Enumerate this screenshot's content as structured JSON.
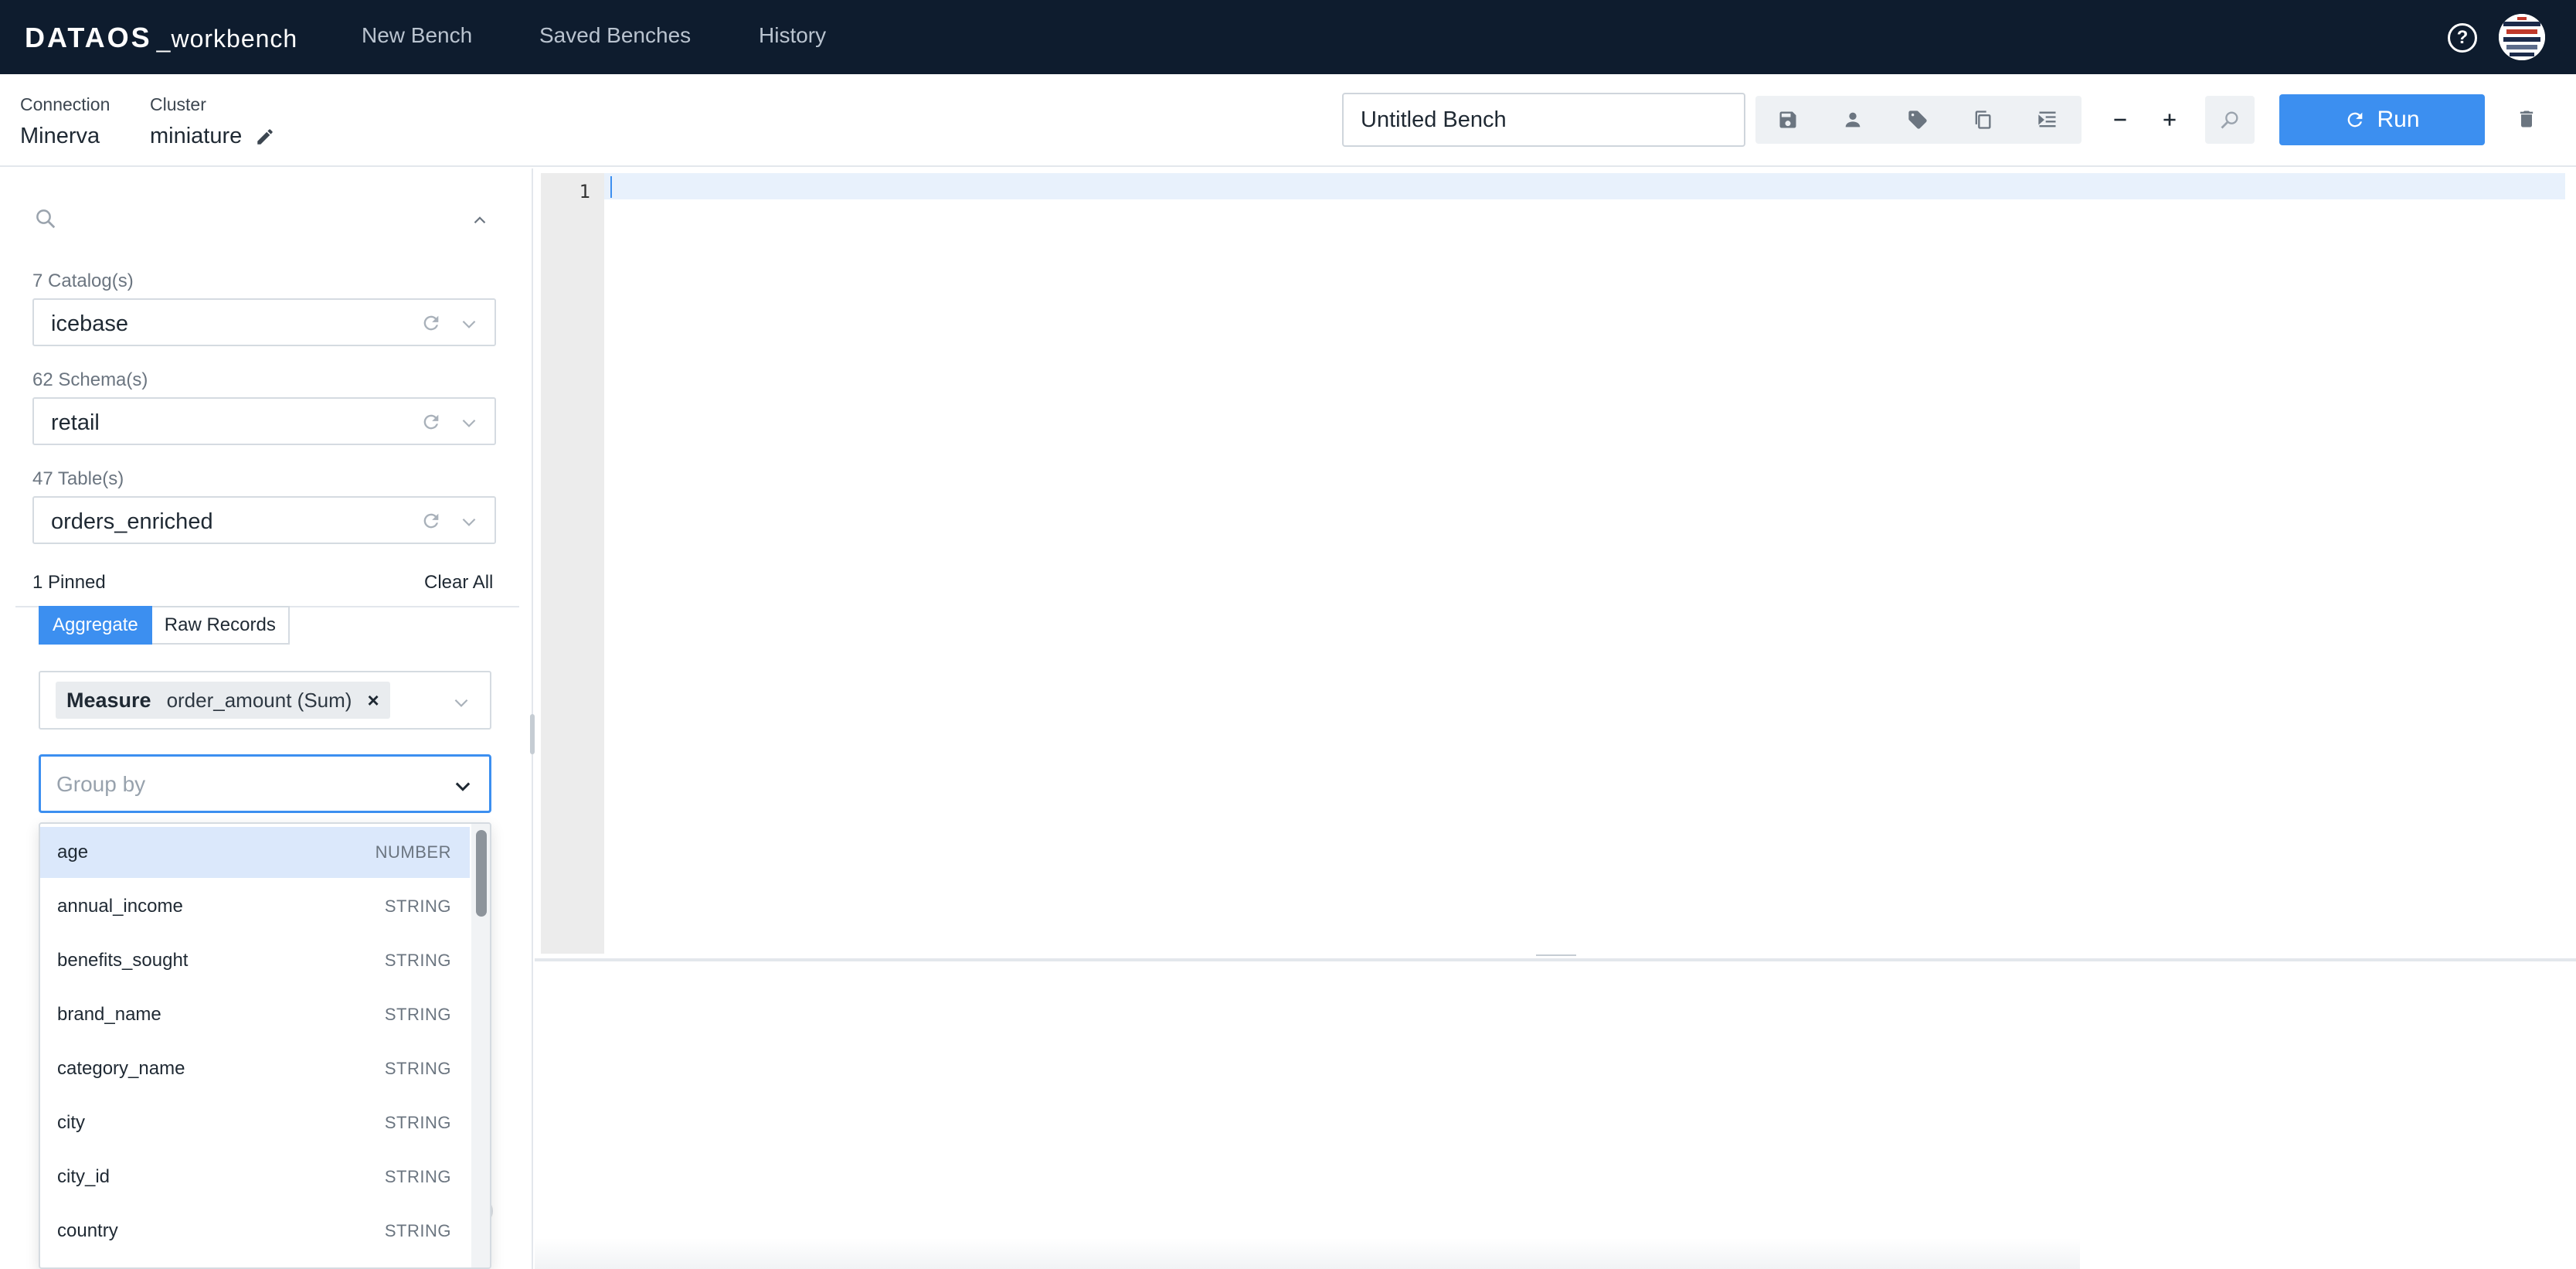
{
  "app": {
    "brand": "DATAOS",
    "product": "_workbench"
  },
  "nav": {
    "items": [
      {
        "label": "New Bench"
      },
      {
        "label": "Saved Benches"
      },
      {
        "label": "History"
      }
    ],
    "help_icon": "question-circle-icon",
    "avatar_icon": "user-avatar-icon"
  },
  "connection": {
    "label": "Connection",
    "value": "Minerva"
  },
  "cluster": {
    "label": "Cluster",
    "value": "miniature",
    "edit_icon": "pencil-icon"
  },
  "toolbar": {
    "bench_name": "Untitled Bench",
    "tools": [
      "save-icon",
      "user-icon",
      "tag-icon",
      "copy-icon",
      "indent-icon"
    ],
    "zoom_out_icon": "minus-icon",
    "zoom_in_icon": "plus-icon",
    "find_icon": "search-replace-icon",
    "run_label": "Run",
    "run_icon": "refresh-icon",
    "delete_icon": "trash-icon",
    "accent_color": "#3c8ff0"
  },
  "sidebar": {
    "catalog": {
      "label": "7 Catalog(s)",
      "value": "icebase"
    },
    "schema": {
      "label": "62 Schema(s)",
      "value": "retail"
    },
    "table": {
      "label": "47 Table(s)",
      "value": "orders_enriched"
    },
    "pinned_label": "1 Pinned",
    "clear_all_label": "Clear All",
    "tabs": [
      {
        "label": "Aggregate",
        "active": true
      },
      {
        "label": "Raw Records",
        "active": false
      }
    ],
    "measure_chip": {
      "key": "Measure",
      "value": "order_amount (Sum)",
      "remove": "×"
    },
    "group_by": {
      "placeholder": "Group by",
      "value": ""
    },
    "group_by_options": [
      {
        "name": "age",
        "type": "NUMBER",
        "highlighted": true
      },
      {
        "name": "annual_income",
        "type": "STRING"
      },
      {
        "name": "benefits_sought",
        "type": "STRING"
      },
      {
        "name": "brand_name",
        "type": "STRING"
      },
      {
        "name": "category_name",
        "type": "STRING"
      },
      {
        "name": "city",
        "type": "STRING"
      },
      {
        "name": "city_id",
        "type": "STRING"
      },
      {
        "name": "country",
        "type": "STRING"
      }
    ]
  },
  "editor": {
    "line_numbers": [
      "1"
    ],
    "content": ""
  }
}
